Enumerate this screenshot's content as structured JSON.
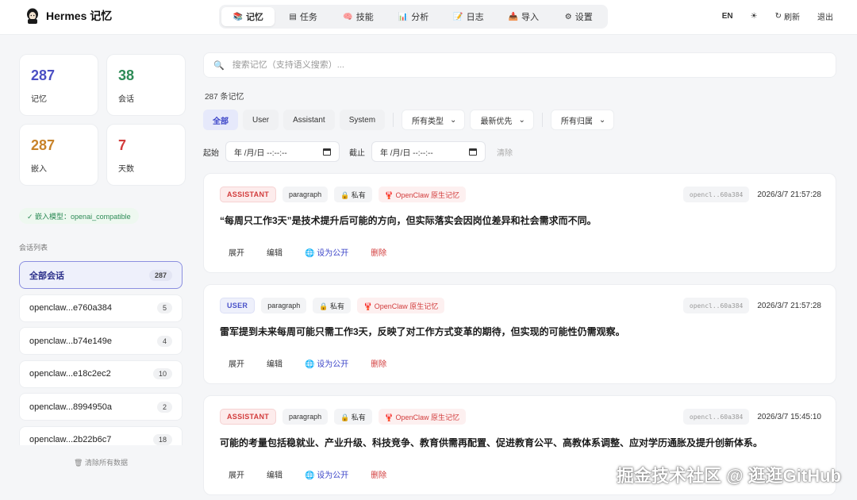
{
  "app": {
    "name": "Hermes 记忆"
  },
  "nav": [
    {
      "icon": "📚",
      "label": "记忆",
      "active": true
    },
    {
      "icon": "▤",
      "label": "任务"
    },
    {
      "icon": "🧠",
      "label": "技能"
    },
    {
      "icon": "📊",
      "label": "分析"
    },
    {
      "icon": "📝",
      "label": "日志"
    },
    {
      "icon": "📥",
      "label": "导入"
    },
    {
      "icon": "⚙",
      "label": "设置"
    }
  ],
  "topright": {
    "lang": "EN",
    "theme_icon": "☀",
    "refresh": "刷新",
    "logout": "退出"
  },
  "stats": [
    {
      "value": "287",
      "label": "记忆",
      "color": "#4b4fc4"
    },
    {
      "value": "38",
      "label": "会话",
      "color": "#2e8b57"
    },
    {
      "value": "287",
      "label": "嵌入",
      "color": "#c8832a"
    },
    {
      "value": "7",
      "label": "天数",
      "color": "#d23c3c"
    }
  ],
  "embed_model": "✓ 嵌入模型：openai_compatible",
  "sessions": {
    "title": "会话列表",
    "items": [
      {
        "name": "全部会话",
        "count": "287",
        "active": true
      },
      {
        "name": "openclaw...e760a384",
        "count": "5"
      },
      {
        "name": "openclaw...b74e149e",
        "count": "4"
      },
      {
        "name": "openclaw...e18c2ec2",
        "count": "10"
      },
      {
        "name": "openclaw...8994950a",
        "count": "2"
      },
      {
        "name": "openclaw...2b22b6c7",
        "count": "18"
      }
    ],
    "clear_all": "🗑 清除所有数据"
  },
  "search": {
    "placeholder": "搜索记忆（支持语义搜索）..."
  },
  "count_text": "287 条记忆",
  "filters": {
    "roles": [
      "全部",
      "User",
      "Assistant",
      "System"
    ],
    "type": "所有类型",
    "sort": "最新优先",
    "owner": "所有归属"
  },
  "date": {
    "start_label": "起始",
    "end_label": "截止",
    "placeholder": "年 /月/日 --:--:--",
    "clear": "清除"
  },
  "memories": [
    {
      "role": "ASSISTANT",
      "role_class": "assistant",
      "kind": "paragraph",
      "privacy": "🔒 私有",
      "source": "🦞 OpenClaw 原生记忆",
      "session": "opencl..60a384",
      "time": "2026/3/7 21:57:28",
      "content": "“每周只工作3天”是技术提升后可能的方向，但实际落实会因岗位差异和社会需求而不同。"
    },
    {
      "role": "USER",
      "role_class": "user",
      "kind": "paragraph",
      "privacy": "🔒 私有",
      "source": "🦞 OpenClaw 原生记忆",
      "session": "opencl..60a384",
      "time": "2026/3/7 21:57:28",
      "content": "雷军提到未来每周可能只需工作3天，反映了对工作方式变革的期待，但实现的可能性仍需观察。"
    },
    {
      "role": "ASSISTANT",
      "role_class": "assistant",
      "kind": "paragraph",
      "privacy": "🔒 私有",
      "source": "🦞 OpenClaw 原生记忆",
      "session": "opencl..60a384",
      "time": "2026/3/7 15:45:10",
      "content": "可能的考量包括稳就业、产业升级、科技竞争、教育供需再配置、促进教育公平、高教体系调整、应对学历通胀及提升创新体系。"
    }
  ],
  "actions": {
    "expand": "展开",
    "edit": "编辑",
    "public": "🌐 设为公开",
    "delete": "删除"
  },
  "watermark": "掘金技术社区 @ 逛逛GitHub"
}
